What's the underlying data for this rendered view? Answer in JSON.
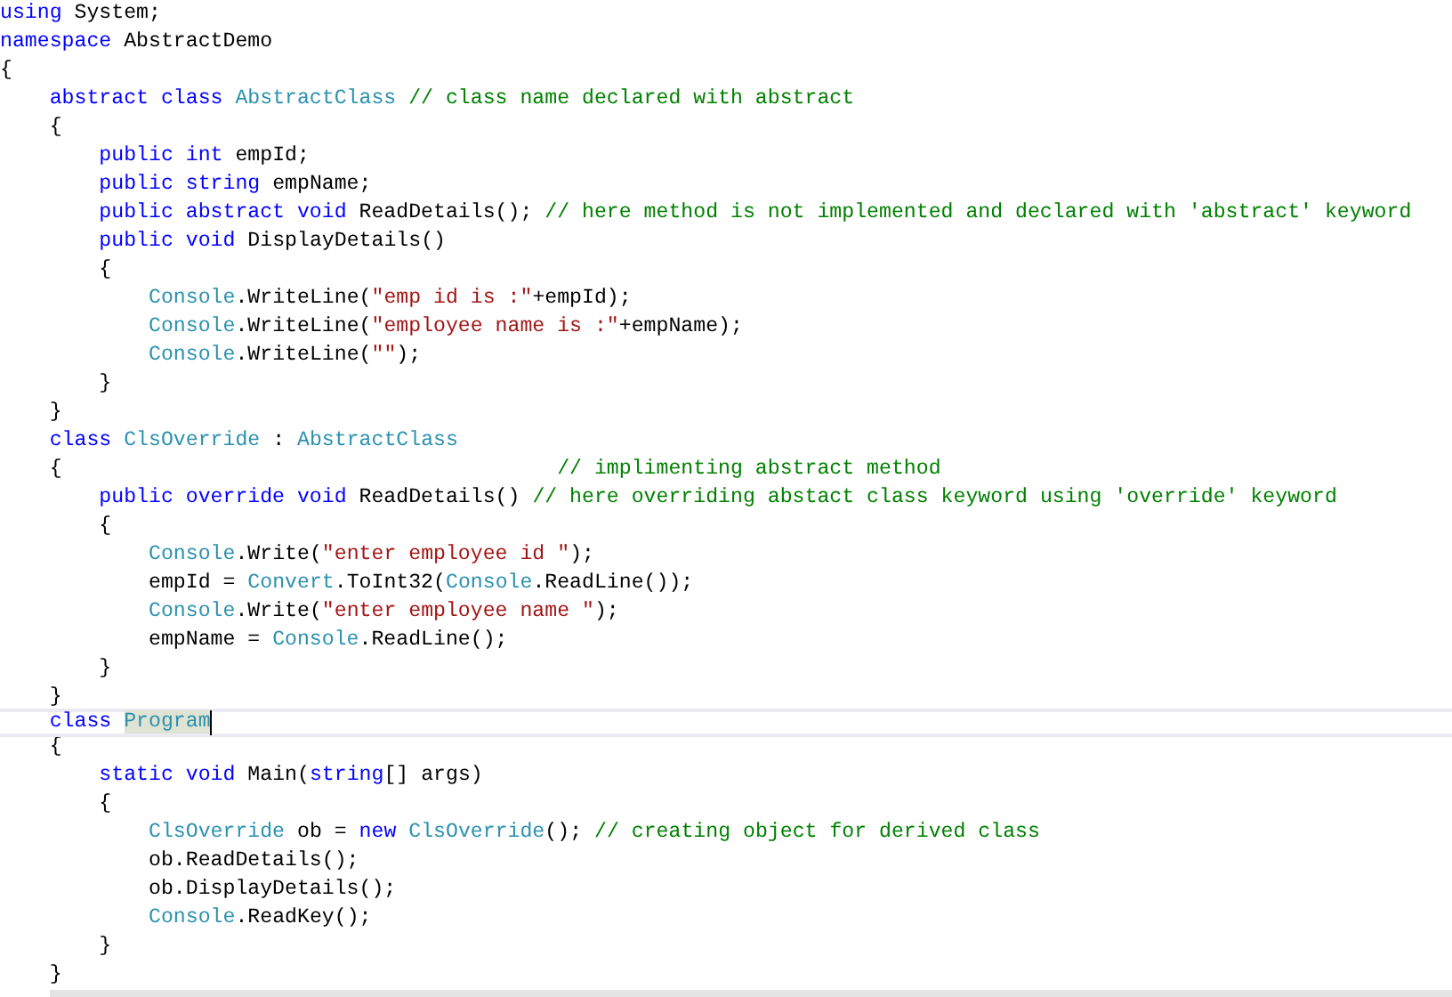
{
  "editor": {
    "lines": [
      {
        "current": false,
        "tokens": [
          {
            "kind": "keyword",
            "text": "using"
          },
          {
            "kind": "plain",
            "text": " System;"
          }
        ]
      },
      {
        "current": false,
        "tokens": [
          {
            "kind": "keyword",
            "text": "namespace"
          },
          {
            "kind": "plain",
            "text": " AbstractDemo"
          }
        ]
      },
      {
        "current": false,
        "tokens": [
          {
            "kind": "plain",
            "text": "{"
          }
        ]
      },
      {
        "current": false,
        "tokens": [
          {
            "kind": "keyword",
            "text": "    abstract class"
          },
          {
            "kind": "type",
            "text": " AbstractClass"
          },
          {
            "kind": "comment",
            "text": " // class name declared with abstract"
          }
        ]
      },
      {
        "current": false,
        "tokens": [
          {
            "kind": "plain",
            "text": "    {"
          }
        ]
      },
      {
        "current": false,
        "tokens": [
          {
            "kind": "keyword",
            "text": "        public int"
          },
          {
            "kind": "plain",
            "text": " empId;"
          }
        ]
      },
      {
        "current": false,
        "tokens": [
          {
            "kind": "keyword",
            "text": "        public string"
          },
          {
            "kind": "plain",
            "text": " empName;"
          }
        ]
      },
      {
        "current": false,
        "tokens": [
          {
            "kind": "keyword",
            "text": "        public abstract void"
          },
          {
            "kind": "plain",
            "text": " ReadDetails(); "
          },
          {
            "kind": "comment",
            "text": "// here method is not implemented and declared with 'abstract' keyword"
          }
        ]
      },
      {
        "current": false,
        "tokens": [
          {
            "kind": "keyword",
            "text": "        public void"
          },
          {
            "kind": "plain",
            "text": " DisplayDetails()"
          }
        ]
      },
      {
        "current": false,
        "tokens": [
          {
            "kind": "plain",
            "text": "        {"
          }
        ]
      },
      {
        "current": false,
        "tokens": [
          {
            "kind": "type",
            "text": "            Console"
          },
          {
            "kind": "plain",
            "text": ".WriteLine("
          },
          {
            "kind": "string",
            "text": "\"emp id is :\""
          },
          {
            "kind": "plain",
            "text": "+empId);"
          }
        ]
      },
      {
        "current": false,
        "tokens": [
          {
            "kind": "type",
            "text": "            Console"
          },
          {
            "kind": "plain",
            "text": ".WriteLine("
          },
          {
            "kind": "string",
            "text": "\"employee name is :\""
          },
          {
            "kind": "plain",
            "text": "+empName);"
          }
        ]
      },
      {
        "current": false,
        "tokens": [
          {
            "kind": "type",
            "text": "            Console"
          },
          {
            "kind": "plain",
            "text": ".WriteLine("
          },
          {
            "kind": "string",
            "text": "\"\""
          },
          {
            "kind": "plain",
            "text": ");"
          }
        ]
      },
      {
        "current": false,
        "tokens": [
          {
            "kind": "plain",
            "text": "        }"
          }
        ]
      },
      {
        "current": false,
        "tokens": [
          {
            "kind": "plain",
            "text": "    }"
          }
        ]
      },
      {
        "current": false,
        "tokens": [
          {
            "kind": "keyword",
            "text": "    class"
          },
          {
            "kind": "type",
            "text": " ClsOverride"
          },
          {
            "kind": "plain",
            "text": " : "
          },
          {
            "kind": "type",
            "text": "AbstractClass"
          }
        ]
      },
      {
        "current": false,
        "tokens": [
          {
            "kind": "plain",
            "text": "    {                                        "
          },
          {
            "kind": "comment",
            "text": "// implimenting abstract method"
          }
        ]
      },
      {
        "current": false,
        "tokens": [
          {
            "kind": "keyword",
            "text": "        public override void"
          },
          {
            "kind": "plain",
            "text": " ReadDetails() "
          },
          {
            "kind": "comment",
            "text": "// here overriding abstact class keyword using 'override' keyword"
          }
        ]
      },
      {
        "current": false,
        "tokens": [
          {
            "kind": "plain",
            "text": "        {"
          }
        ]
      },
      {
        "current": false,
        "tokens": [
          {
            "kind": "type",
            "text": "            Console"
          },
          {
            "kind": "plain",
            "text": ".Write("
          },
          {
            "kind": "string",
            "text": "\"enter employee id \""
          },
          {
            "kind": "plain",
            "text": ");"
          }
        ]
      },
      {
        "current": false,
        "tokens": [
          {
            "kind": "plain",
            "text": "            empId = "
          },
          {
            "kind": "type",
            "text": "Convert"
          },
          {
            "kind": "plain",
            "text": ".ToInt32("
          },
          {
            "kind": "type",
            "text": "Console"
          },
          {
            "kind": "plain",
            "text": ".ReadLine());"
          }
        ]
      },
      {
        "current": false,
        "tokens": [
          {
            "kind": "type",
            "text": "            Console"
          },
          {
            "kind": "plain",
            "text": ".Write("
          },
          {
            "kind": "string",
            "text": "\"enter employee name \""
          },
          {
            "kind": "plain",
            "text": ");"
          }
        ]
      },
      {
        "current": false,
        "tokens": [
          {
            "kind": "plain",
            "text": "            empName = "
          },
          {
            "kind": "type",
            "text": "Console"
          },
          {
            "kind": "plain",
            "text": ".ReadLine();"
          }
        ]
      },
      {
        "current": false,
        "tokens": [
          {
            "kind": "plain",
            "text": "        }"
          }
        ]
      },
      {
        "current": false,
        "tokens": [
          {
            "kind": "plain",
            "text": "    }"
          }
        ]
      },
      {
        "current": true,
        "tokens": [
          {
            "kind": "keyword",
            "text": "    class "
          },
          {
            "kind": "type-highlight",
            "text": "Program"
          }
        ]
      },
      {
        "current": false,
        "tokens": [
          {
            "kind": "plain",
            "text": "    {"
          }
        ]
      },
      {
        "current": false,
        "tokens": [
          {
            "kind": "keyword",
            "text": "        static void"
          },
          {
            "kind": "plain",
            "text": " Main("
          },
          {
            "kind": "keyword",
            "text": "string"
          },
          {
            "kind": "plain",
            "text": "[] args)"
          }
        ]
      },
      {
        "current": false,
        "tokens": [
          {
            "kind": "plain",
            "text": "        {"
          }
        ]
      },
      {
        "current": false,
        "tokens": [
          {
            "kind": "type",
            "text": "            ClsOverride"
          },
          {
            "kind": "plain",
            "text": " ob = "
          },
          {
            "kind": "keyword",
            "text": "new"
          },
          {
            "kind": "type",
            "text": " ClsOverride"
          },
          {
            "kind": "plain",
            "text": "(); "
          },
          {
            "kind": "comment",
            "text": "// creating object for derived class"
          }
        ]
      },
      {
        "current": false,
        "tokens": [
          {
            "kind": "plain",
            "text": "            ob.ReadDetails();"
          }
        ]
      },
      {
        "current": false,
        "tokens": [
          {
            "kind": "plain",
            "text": "            ob.DisplayDetails();"
          }
        ]
      },
      {
        "current": false,
        "tokens": [
          {
            "kind": "type",
            "text": "            Console"
          },
          {
            "kind": "plain",
            "text": ".ReadKey();"
          }
        ]
      },
      {
        "current": false,
        "tokens": [
          {
            "kind": "plain",
            "text": "        }"
          }
        ]
      },
      {
        "current": false,
        "tokens": [
          {
            "kind": "plain",
            "text": "    }"
          }
        ]
      }
    ]
  }
}
